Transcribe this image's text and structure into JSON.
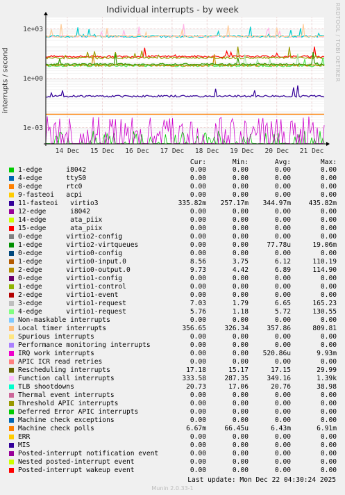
{
  "title": "Individual interrupts - by week",
  "side_text": "RRDTOOL / TOBI OETIKER",
  "footer": "Munin 2.0.33-1",
  "last_update": "Last update:  Mon Dec 22 04:30:24 2025",
  "headers": {
    "cur": "Cur:",
    "min": "Min:",
    "avg": "Avg:",
    "max": "Max:"
  },
  "chart_data": {
    "type": "line",
    "title": "Individual interrupts - by week",
    "ylabel": "interrupts / second",
    "yscale": "log",
    "ylim": [
      0.0001,
      5000
    ],
    "yticks": [
      "1e+03",
      "1e+00",
      "1e-03"
    ],
    "yticks_values": [
      1000,
      1,
      0.001
    ],
    "xticks": [
      "14 Dec",
      "15 Dec",
      "16 Dec",
      "17 Dec",
      "18 Dec",
      "19 Dec",
      "20 Dec",
      "21 Dec"
    ],
    "grid": true,
    "series_levels": [
      {
        "name": "Function call interrupts",
        "color": "#ffb3e6",
        "level": 349.16
      },
      {
        "name": "11-fasteoi virtio3",
        "color": "#00cccc",
        "level": 344.97
      },
      {
        "name": "Local timer interrupts",
        "color": "#ffcc99",
        "level": 357.86
      },
      {
        "name": "TLB shootdowns",
        "color": "#ff0000",
        "level": 20.76
      },
      {
        "name": "Rescheduling interrupts",
        "color": "#999900",
        "level": 17.15
      },
      {
        "name": "3-edge virtio1-request",
        "color": "#a6e6a6",
        "level": 6.65
      },
      {
        "name": "4-edge virtio1-request",
        "color": "#55e655",
        "level": 5.72
      },
      {
        "name": "1-edge virtio0-input.0",
        "color": "#cc8800",
        "level": 6.12
      },
      {
        "name": "2-edge virtio0-output.0",
        "color": "#339900",
        "level": 6.89
      },
      {
        "name": "MIS",
        "color": "#330099",
        "level": 0.08
      },
      {
        "name": "Machine check polls",
        "color": "#ff7f00",
        "level": 0.00643
      },
      {
        "name": "1-edge virtio2-virtqueues",
        "color": "#00cc00",
        "level": 7.78e-05
      },
      {
        "name": "IRQ work interrupts",
        "color": "#cc00cc",
        "level": 0.000521
      }
    ]
  },
  "legend": [
    {
      "label": "1-edge      i8042",
      "color": "#00cc00",
      "cur": "0.00",
      "min": "0.00",
      "avg": "0.00",
      "max": "0.00"
    },
    {
      "label": "4-edge      ttyS0",
      "color": "#0066b3",
      "cur": "0.00",
      "min": "0.00",
      "avg": "0.00",
      "max": "0.00"
    },
    {
      "label": "8-edge      rtc0",
      "color": "#ff8000",
      "cur": "0.00",
      "min": "0.00",
      "avg": "0.00",
      "max": "0.00"
    },
    {
      "label": "9-fasteoi   acpi",
      "color": "#ffcc00",
      "cur": "0.00",
      "min": "0.00",
      "avg": "0.00",
      "max": "0.00"
    },
    {
      "label": "11-fasteoi   virtio3",
      "color": "#330099",
      "cur": "335.82m",
      "min": "257.17m",
      "avg": "344.97m",
      "max": "435.82m"
    },
    {
      "label": "12-edge      i8042",
      "color": "#990099",
      "cur": "0.00",
      "min": "0.00",
      "avg": "0.00",
      "max": "0.00"
    },
    {
      "label": "14-edge      ata_piix",
      "color": "#ccff00",
      "cur": "0.00",
      "min": "0.00",
      "avg": "0.00",
      "max": "0.00"
    },
    {
      "label": "15-edge      ata_piix",
      "color": "#ff0000",
      "cur": "0.00",
      "min": "0.00",
      "avg": "0.00",
      "max": "0.00"
    },
    {
      "label": "0-edge      virtio2-config",
      "color": "#808080",
      "cur": "0.00",
      "min": "0.00",
      "avg": "0.00",
      "max": "0.00"
    },
    {
      "label": "1-edge      virtio2-virtqueues",
      "color": "#008f00",
      "cur": "0.00",
      "min": "0.00",
      "avg": "77.78u",
      "max": "19.06m"
    },
    {
      "label": "0-edge      virtio0-config",
      "color": "#00487d",
      "cur": "0.00",
      "min": "0.00",
      "avg": "0.00",
      "max": "0.00"
    },
    {
      "label": "1-edge      virtio0-input.0",
      "color": "#b35a00",
      "cur": "8.56",
      "min": "3.75",
      "avg": "6.12",
      "max": "110.19"
    },
    {
      "label": "2-edge      virtio0-output.0",
      "color": "#b38f00",
      "cur": "9.73",
      "min": "4.42",
      "avg": "6.89",
      "max": "114.90"
    },
    {
      "label": "0-edge      virtio1-config",
      "color": "#6b006b",
      "cur": "0.00",
      "min": "0.00",
      "avg": "0.00",
      "max": "0.00"
    },
    {
      "label": "1-edge      virtio1-control",
      "color": "#8fb300",
      "cur": "0.00",
      "min": "0.00",
      "avg": "0.00",
      "max": "0.00"
    },
    {
      "label": "2-edge      virtio1-event",
      "color": "#b30000",
      "cur": "0.00",
      "min": "0.00",
      "avg": "0.00",
      "max": "0.00"
    },
    {
      "label": "3-edge      virtio1-request",
      "color": "#bebebe",
      "cur": "7.03",
      "min": "1.79",
      "avg": "6.65",
      "max": "165.23"
    },
    {
      "label": "4-edge      virtio1-request",
      "color": "#80ff80",
      "cur": "5.76",
      "min": "1.18",
      "avg": "5.72",
      "max": "130.55"
    },
    {
      "label": "Non-maskable interrupts",
      "color": "#80c9ff",
      "cur": "0.00",
      "min": "0.00",
      "avg": "0.00",
      "max": "0.00"
    },
    {
      "label": "Local timer interrupts",
      "color": "#ffc080",
      "cur": "356.65",
      "min": "326.34",
      "avg": "357.86",
      "max": "809.81"
    },
    {
      "label": "Spurious interrupts",
      "color": "#ffe680",
      "cur": "0.00",
      "min": "0.00",
      "avg": "0.00",
      "max": "0.00"
    },
    {
      "label": "Performance monitoring interrupts",
      "color": "#aa80ff",
      "cur": "0.00",
      "min": "0.00",
      "avg": "0.00",
      "max": "0.00"
    },
    {
      "label": "IRQ work interrupts",
      "color": "#ee00cc",
      "cur": "0.00",
      "min": "0.00",
      "avg": "520.86u",
      "max": "9.93m"
    },
    {
      "label": "APIC ICR read retries",
      "color": "#ff8080",
      "cur": "0.00",
      "min": "0.00",
      "avg": "0.00",
      "max": "0.00"
    },
    {
      "label": "Rescheduling interrupts",
      "color": "#666600",
      "cur": "17.18",
      "min": "15.17",
      "avg": "17.15",
      "max": "29.99"
    },
    {
      "label": "Function call interrupts",
      "color": "#ffbfff",
      "cur": "333.58",
      "min": "287.35",
      "avg": "349.16",
      "max": "1.39k"
    },
    {
      "label": "TLB shootdowns",
      "color": "#00ffcc",
      "cur": "20.73",
      "min": "17.06",
      "avg": "20.76",
      "max": "38.98"
    },
    {
      "label": "Thermal event interrupts",
      "color": "#cc6699",
      "cur": "0.00",
      "min": "0.00",
      "avg": "0.00",
      "max": "0.00"
    },
    {
      "label": "Threshold APIC interrupts",
      "color": "#999900",
      "cur": "0.00",
      "min": "0.00",
      "avg": "0.00",
      "max": "0.00"
    },
    {
      "label": "Deferred Error APIC interrupts",
      "color": "#00cc00",
      "cur": "0.00",
      "min": "0.00",
      "avg": "0.00",
      "max": "0.00"
    },
    {
      "label": "Machine check exceptions",
      "color": "#0066b3",
      "cur": "0.00",
      "min": "0.00",
      "avg": "0.00",
      "max": "0.00"
    },
    {
      "label": "Machine check polls",
      "color": "#ff8000",
      "cur": "6.67m",
      "min": "66.45u",
      "avg": "6.43m",
      "max": "6.91m"
    },
    {
      "label": "ERR",
      "color": "#ffcc00",
      "cur": "0.00",
      "min": "0.00",
      "avg": "0.00",
      "max": "0.00"
    },
    {
      "label": "MIS",
      "color": "#330099",
      "cur": "0.00",
      "min": "0.00",
      "avg": "0.00",
      "max": "0.00"
    },
    {
      "label": "Posted-interrupt notification event",
      "color": "#990099",
      "cur": "0.00",
      "min": "0.00",
      "avg": "0.00",
      "max": "0.00"
    },
    {
      "label": "Nested posted-interrupt event",
      "color": "#ccff00",
      "cur": "0.00",
      "min": "0.00",
      "avg": "0.00",
      "max": "0.00"
    },
    {
      "label": "Posted-interrupt wakeup event",
      "color": "#ff0000",
      "cur": "0.00",
      "min": "0.00",
      "avg": "0.00",
      "max": "0.00"
    }
  ]
}
